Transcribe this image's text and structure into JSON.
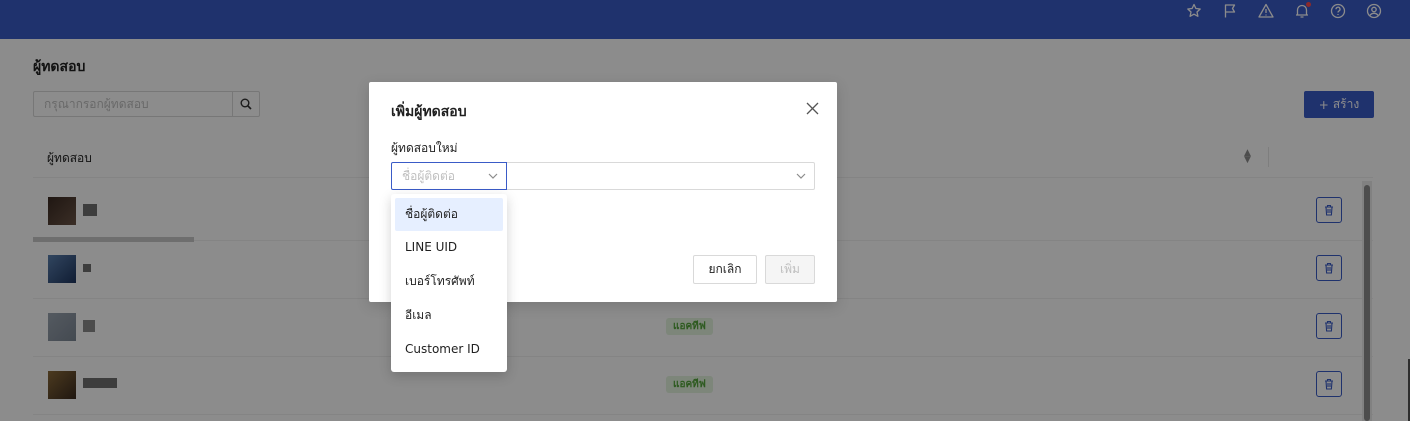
{
  "colors": {
    "brand": "#3a5bc7",
    "status_active_bg": "#e3f4de",
    "status_active_fg": "#52a43a"
  },
  "header": {
    "icons": [
      "star-icon",
      "flag-icon",
      "warning-icon",
      "bell-icon",
      "help-icon",
      "user-icon"
    ]
  },
  "page": {
    "title": "ผู้ทดสอบ",
    "search": {
      "placeholder": "กรุณากรอกผู้ทดสอบ"
    },
    "create_label": "สร้าง",
    "table": {
      "column_tester": "ผู้ทดสอบ",
      "rows": [
        {
          "status": ""
        },
        {
          "status": ""
        },
        {
          "status": "แอคทีฟ"
        },
        {
          "status": "แอคทีฟ"
        }
      ]
    }
  },
  "modal": {
    "title": "เพิ่มผู้ทดสอบ",
    "field_label": "ผู้ทดสอบใหม่",
    "type_select": {
      "placeholder": "ชื่อผู้ติดต่อ"
    },
    "cancel_label": "ยกเลิก",
    "add_label": "เพิ่ม"
  },
  "dropdown": {
    "options": [
      {
        "label": "ชื่อผู้ติดต่อ",
        "selected": true
      },
      {
        "label": "LINE UID",
        "selected": false
      },
      {
        "label": "เบอร์โทรศัพท์",
        "selected": false
      },
      {
        "label": "อีเมล",
        "selected": false
      },
      {
        "label": "Customer ID",
        "selected": false
      }
    ]
  }
}
